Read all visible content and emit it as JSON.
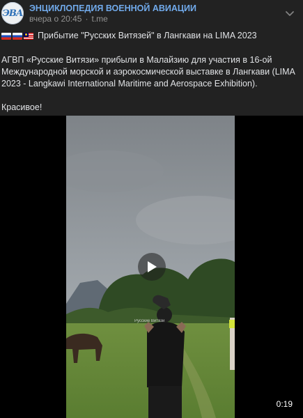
{
  "post": {
    "author": "ЭНЦИКЛОПЕДИЯ ВОЕННОЙ АВИАЦИИ",
    "avatar_text": "ЭВА",
    "time": "вчера о 20:45",
    "source": "t.me",
    "flags": [
      "flag-russia",
      "flag-russia",
      "flag-malaysia"
    ],
    "headline": "Прибытие \"Русских Витязей\" в Лангкави на LIMA 2023",
    "paragraph": "АГВП «Русские Витязи» прибыли в Малайзию для участия в 16-ой Международной морской и аэрокосмической выставке в Лангкави (LIMA 2023 - Langkawi International Maritime and Aerospace Exhibition).",
    "closing": "Красивое!"
  },
  "video": {
    "duration": "0:19",
    "watermark": "Русские Витязи"
  },
  "icons": {
    "menu": "chevron-down-icon",
    "play": "play-icon"
  },
  "colors": {
    "background": "#222222",
    "author_link": "#71aaeb",
    "meta": "#939393",
    "text": "#e1e3e6"
  }
}
